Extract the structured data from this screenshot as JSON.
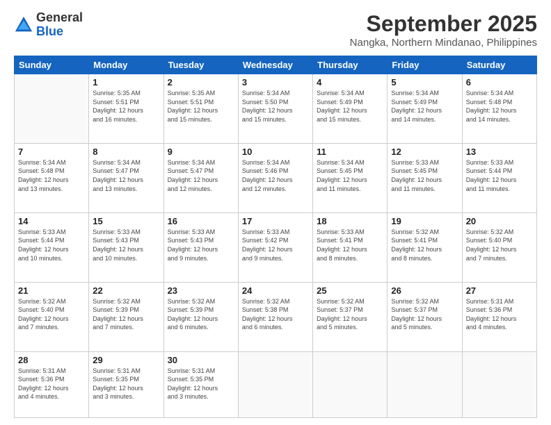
{
  "logo": {
    "general": "General",
    "blue": "Blue"
  },
  "header": {
    "month": "September 2025",
    "location": "Nangka, Northern Mindanao, Philippines"
  },
  "weekdays": [
    "Sunday",
    "Monday",
    "Tuesday",
    "Wednesday",
    "Thursday",
    "Friday",
    "Saturday"
  ],
  "weeks": [
    [
      {
        "day": "",
        "info": ""
      },
      {
        "day": "1",
        "info": "Sunrise: 5:35 AM\nSunset: 5:51 PM\nDaylight: 12 hours\nand 16 minutes."
      },
      {
        "day": "2",
        "info": "Sunrise: 5:35 AM\nSunset: 5:51 PM\nDaylight: 12 hours\nand 15 minutes."
      },
      {
        "day": "3",
        "info": "Sunrise: 5:34 AM\nSunset: 5:50 PM\nDaylight: 12 hours\nand 15 minutes."
      },
      {
        "day": "4",
        "info": "Sunrise: 5:34 AM\nSunset: 5:49 PM\nDaylight: 12 hours\nand 15 minutes."
      },
      {
        "day": "5",
        "info": "Sunrise: 5:34 AM\nSunset: 5:49 PM\nDaylight: 12 hours\nand 14 minutes."
      },
      {
        "day": "6",
        "info": "Sunrise: 5:34 AM\nSunset: 5:48 PM\nDaylight: 12 hours\nand 14 minutes."
      }
    ],
    [
      {
        "day": "7",
        "info": "Sunrise: 5:34 AM\nSunset: 5:48 PM\nDaylight: 12 hours\nand 13 minutes."
      },
      {
        "day": "8",
        "info": "Sunrise: 5:34 AM\nSunset: 5:47 PM\nDaylight: 12 hours\nand 13 minutes."
      },
      {
        "day": "9",
        "info": "Sunrise: 5:34 AM\nSunset: 5:47 PM\nDaylight: 12 hours\nand 12 minutes."
      },
      {
        "day": "10",
        "info": "Sunrise: 5:34 AM\nSunset: 5:46 PM\nDaylight: 12 hours\nand 12 minutes."
      },
      {
        "day": "11",
        "info": "Sunrise: 5:34 AM\nSunset: 5:45 PM\nDaylight: 12 hours\nand 11 minutes."
      },
      {
        "day": "12",
        "info": "Sunrise: 5:33 AM\nSunset: 5:45 PM\nDaylight: 12 hours\nand 11 minutes."
      },
      {
        "day": "13",
        "info": "Sunrise: 5:33 AM\nSunset: 5:44 PM\nDaylight: 12 hours\nand 11 minutes."
      }
    ],
    [
      {
        "day": "14",
        "info": "Sunrise: 5:33 AM\nSunset: 5:44 PM\nDaylight: 12 hours\nand 10 minutes."
      },
      {
        "day": "15",
        "info": "Sunrise: 5:33 AM\nSunset: 5:43 PM\nDaylight: 12 hours\nand 10 minutes."
      },
      {
        "day": "16",
        "info": "Sunrise: 5:33 AM\nSunset: 5:43 PM\nDaylight: 12 hours\nand 9 minutes."
      },
      {
        "day": "17",
        "info": "Sunrise: 5:33 AM\nSunset: 5:42 PM\nDaylight: 12 hours\nand 9 minutes."
      },
      {
        "day": "18",
        "info": "Sunrise: 5:33 AM\nSunset: 5:41 PM\nDaylight: 12 hours\nand 8 minutes."
      },
      {
        "day": "19",
        "info": "Sunrise: 5:32 AM\nSunset: 5:41 PM\nDaylight: 12 hours\nand 8 minutes."
      },
      {
        "day": "20",
        "info": "Sunrise: 5:32 AM\nSunset: 5:40 PM\nDaylight: 12 hours\nand 7 minutes."
      }
    ],
    [
      {
        "day": "21",
        "info": "Sunrise: 5:32 AM\nSunset: 5:40 PM\nDaylight: 12 hours\nand 7 minutes."
      },
      {
        "day": "22",
        "info": "Sunrise: 5:32 AM\nSunset: 5:39 PM\nDaylight: 12 hours\nand 7 minutes."
      },
      {
        "day": "23",
        "info": "Sunrise: 5:32 AM\nSunset: 5:39 PM\nDaylight: 12 hours\nand 6 minutes."
      },
      {
        "day": "24",
        "info": "Sunrise: 5:32 AM\nSunset: 5:38 PM\nDaylight: 12 hours\nand 6 minutes."
      },
      {
        "day": "25",
        "info": "Sunrise: 5:32 AM\nSunset: 5:37 PM\nDaylight: 12 hours\nand 5 minutes."
      },
      {
        "day": "26",
        "info": "Sunrise: 5:32 AM\nSunset: 5:37 PM\nDaylight: 12 hours\nand 5 minutes."
      },
      {
        "day": "27",
        "info": "Sunrise: 5:31 AM\nSunset: 5:36 PM\nDaylight: 12 hours\nand 4 minutes."
      }
    ],
    [
      {
        "day": "28",
        "info": "Sunrise: 5:31 AM\nSunset: 5:36 PM\nDaylight: 12 hours\nand 4 minutes."
      },
      {
        "day": "29",
        "info": "Sunrise: 5:31 AM\nSunset: 5:35 PM\nDaylight: 12 hours\nand 3 minutes."
      },
      {
        "day": "30",
        "info": "Sunrise: 5:31 AM\nSunset: 5:35 PM\nDaylight: 12 hours\nand 3 minutes."
      },
      {
        "day": "",
        "info": ""
      },
      {
        "day": "",
        "info": ""
      },
      {
        "day": "",
        "info": ""
      },
      {
        "day": "",
        "info": ""
      }
    ]
  ]
}
